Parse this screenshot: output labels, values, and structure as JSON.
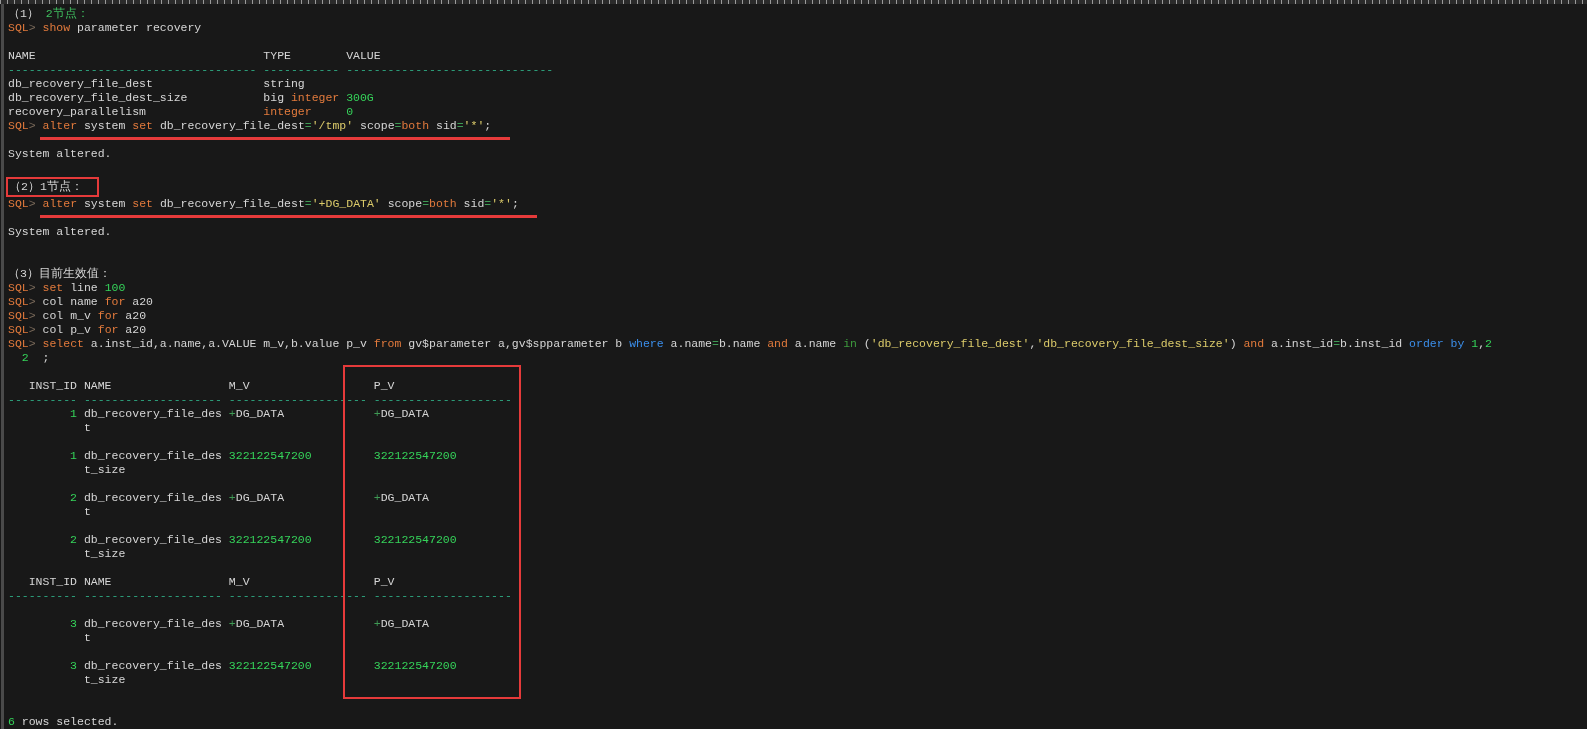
{
  "lines": [
    {
      "kind": "text",
      "segments": [
        {
          "kind": "txt",
          "text": "（1）"
        },
        {
          "kind": "head",
          "text": " 2节点："
        }
      ]
    },
    {
      "kind": "text",
      "segments": [
        {
          "kind": "prompt",
          "text": "SQL"
        },
        {
          "kind": "gt",
          "text": ">"
        },
        {
          "kind": "kw",
          "text": " show"
        },
        {
          "kind": "txt",
          "text": " parameter recovery"
        }
      ]
    },
    {
      "kind": "blank"
    },
    {
      "kind": "text",
      "segments": [
        {
          "kind": "txt",
          "text": "NAME                                 TYPE        VALUE"
        }
      ]
    },
    {
      "kind": "text",
      "segments": [
        {
          "kind": "rule",
          "text": "------------------------------------ ----------- ------------------------------"
        }
      ]
    },
    {
      "kind": "text",
      "segments": [
        {
          "kind": "txt",
          "text": "db_recovery_file_dest                string"
        }
      ]
    },
    {
      "kind": "text",
      "segments": [
        {
          "kind": "txt",
          "text": "db_recovery_file_dest_size           big "
        },
        {
          "kind": "kw",
          "text": "integer"
        },
        {
          "kind": "num",
          "text": " 300G"
        }
      ]
    },
    {
      "kind": "text",
      "segments": [
        {
          "kind": "txt",
          "text": "recovery_parallelism                 "
        },
        {
          "kind": "kw",
          "text": "integer"
        },
        {
          "kind": "num",
          "text": "     0"
        }
      ]
    },
    {
      "kind": "text",
      "underline": true,
      "segments": [
        {
          "kind": "prompt",
          "text": "SQL"
        },
        {
          "kind": "gt",
          "text": ">"
        },
        {
          "kind": "kw",
          "text": " alter"
        },
        {
          "kind": "txt",
          "text": " system "
        },
        {
          "kind": "kw",
          "text": "set"
        },
        {
          "kind": "txt",
          "text": " db_recovery_file_dest"
        },
        {
          "kind": "op",
          "text": "="
        },
        {
          "kind": "str",
          "text": "'/tmp'"
        },
        {
          "kind": "txt",
          "text": " scope"
        },
        {
          "kind": "op",
          "text": "="
        },
        {
          "kind": "kw",
          "text": "both"
        },
        {
          "kind": "txt",
          "text": " sid"
        },
        {
          "kind": "op",
          "text": "="
        },
        {
          "kind": "str",
          "text": "'*'"
        },
        {
          "kind": "txt",
          "text": ";"
        }
      ]
    },
    {
      "kind": "text",
      "segments": [
        {
          "kind": "txt",
          "text": "System altered."
        }
      ]
    },
    {
      "kind": "blank"
    },
    {
      "kind": "text",
      "boxed": true,
      "segments": [
        {
          "kind": "txt",
          "text": "（2）1节点："
        }
      ]
    },
    {
      "kind": "text",
      "underline": true,
      "segments": [
        {
          "kind": "prompt",
          "text": "SQL"
        },
        {
          "kind": "gt",
          "text": ">"
        },
        {
          "kind": "kw",
          "text": " alter"
        },
        {
          "kind": "txt",
          "text": " system "
        },
        {
          "kind": "kw",
          "text": "set"
        },
        {
          "kind": "txt",
          "text": " db_recovery_file_dest"
        },
        {
          "kind": "op",
          "text": "="
        },
        {
          "kind": "str",
          "text": "'+DG_DATA'"
        },
        {
          "kind": "txt",
          "text": " scope"
        },
        {
          "kind": "op",
          "text": "="
        },
        {
          "kind": "kw",
          "text": "both"
        },
        {
          "kind": "txt",
          "text": " sid"
        },
        {
          "kind": "op",
          "text": "="
        },
        {
          "kind": "str",
          "text": "'*'"
        },
        {
          "kind": "txt",
          "text": ";"
        }
      ]
    },
    {
      "kind": "text",
      "segments": [
        {
          "kind": "txt",
          "text": "System altered."
        }
      ]
    },
    {
      "kind": "blank"
    },
    {
      "kind": "blank"
    },
    {
      "kind": "text",
      "segments": [
        {
          "kind": "txt",
          "text": "（3）目前生效值："
        }
      ]
    },
    {
      "kind": "text",
      "segments": [
        {
          "kind": "prompt",
          "text": "SQL"
        },
        {
          "kind": "gt",
          "text": ">"
        },
        {
          "kind": "kw",
          "text": " set"
        },
        {
          "kind": "txt",
          "text": " line "
        },
        {
          "kind": "num",
          "text": "100"
        }
      ]
    },
    {
      "kind": "text",
      "segments": [
        {
          "kind": "prompt",
          "text": "SQL"
        },
        {
          "kind": "gt",
          "text": ">"
        },
        {
          "kind": "txt",
          "text": " col name "
        },
        {
          "kind": "kw",
          "text": "for"
        },
        {
          "kind": "txt",
          "text": " a20"
        }
      ]
    },
    {
      "kind": "text",
      "segments": [
        {
          "kind": "prompt",
          "text": "SQL"
        },
        {
          "kind": "gt",
          "text": ">"
        },
        {
          "kind": "txt",
          "text": " col m_v "
        },
        {
          "kind": "kw",
          "text": "for"
        },
        {
          "kind": "txt",
          "text": " a20"
        }
      ]
    },
    {
      "kind": "text",
      "segments": [
        {
          "kind": "prompt",
          "text": "SQL"
        },
        {
          "kind": "gt",
          "text": ">"
        },
        {
          "kind": "txt",
          "text": " col p_v "
        },
        {
          "kind": "kw",
          "text": "for"
        },
        {
          "kind": "txt",
          "text": " a20"
        }
      ]
    },
    {
      "kind": "text",
      "segments": [
        {
          "kind": "prompt",
          "text": "SQL"
        },
        {
          "kind": "gt",
          "text": ">"
        },
        {
          "kind": "kw",
          "text": " select"
        },
        {
          "kind": "txt",
          "text": " a.inst_id,a.name,a.VALUE m_v,b.value p_v "
        },
        {
          "kind": "kw",
          "text": "from"
        },
        {
          "kind": "txt",
          "text": " gv$parameter a,gv$spparameter b "
        },
        {
          "kind": "blue",
          "text": "where"
        },
        {
          "kind": "txt",
          "text": " a.name"
        },
        {
          "kind": "op",
          "text": "="
        },
        {
          "kind": "txt",
          "text": "b.name "
        },
        {
          "kind": "kw",
          "text": "and"
        },
        {
          "kind": "txt",
          "text": " a.name "
        },
        {
          "kind": "in",
          "text": "in"
        },
        {
          "kind": "txt",
          "text": " ("
        },
        {
          "kind": "str",
          "text": "'db_recovery_file_dest'"
        },
        {
          "kind": "txt",
          "text": ","
        },
        {
          "kind": "str",
          "text": "'db_recovery_file_dest_size'"
        },
        {
          "kind": "txt",
          "text": ") "
        },
        {
          "kind": "kw",
          "text": "and"
        },
        {
          "kind": "txt",
          "text": " a.inst_id"
        },
        {
          "kind": "op",
          "text": "="
        },
        {
          "kind": "txt",
          "text": "b.inst_id "
        },
        {
          "kind": "blue",
          "text": "order by"
        },
        {
          "kind": "num",
          "text": " 1"
        },
        {
          "kind": "txt",
          "text": ","
        },
        {
          "kind": "num",
          "text": "2"
        }
      ]
    },
    {
      "kind": "text",
      "segments": [
        {
          "kind": "num",
          "text": "  2"
        },
        {
          "kind": "txt",
          "text": "  ;"
        }
      ]
    },
    {
      "kind": "blank"
    },
    {
      "kind": "group",
      "highlight": true,
      "lines": [
        {
          "kind": "text",
          "segments": [
            {
              "kind": "txt",
              "text": "   INST_ID NAME                 M_V                  P_V"
            }
          ]
        },
        {
          "kind": "text",
          "segments": [
            {
              "kind": "rule",
              "text": "---------- -------------------- -------------------- --------------------"
            }
          ]
        },
        {
          "kind": "text",
          "segments": [
            {
              "kind": "num",
              "text": "         1"
            },
            {
              "kind": "txt",
              "text": " db_recovery_file_des "
            },
            {
              "kind": "op",
              "text": "+"
            },
            {
              "kind": "txt",
              "text": "DG_DATA             "
            },
            {
              "kind": "op",
              "text": "+"
            },
            {
              "kind": "txt",
              "text": "DG_DATA"
            }
          ]
        },
        {
          "kind": "text",
          "segments": [
            {
              "kind": "txt",
              "text": "           t"
            }
          ]
        },
        {
          "kind": "blank"
        },
        {
          "kind": "text",
          "segments": [
            {
              "kind": "num",
              "text": "         1"
            },
            {
              "kind": "txt",
              "text": " db_recovery_file_des "
            },
            {
              "kind": "num",
              "text": "322122547200"
            },
            {
              "kind": "num",
              "text": "         322122547200"
            }
          ]
        },
        {
          "kind": "text",
          "segments": [
            {
              "kind": "txt",
              "text": "           t_size"
            }
          ]
        },
        {
          "kind": "blank"
        },
        {
          "kind": "text",
          "segments": [
            {
              "kind": "num",
              "text": "         2"
            },
            {
              "kind": "txt",
              "text": " db_recovery_file_des "
            },
            {
              "kind": "op",
              "text": "+"
            },
            {
              "kind": "txt",
              "text": "DG_DATA             "
            },
            {
              "kind": "op",
              "text": "+"
            },
            {
              "kind": "txt",
              "text": "DG_DATA"
            }
          ]
        },
        {
          "kind": "text",
          "segments": [
            {
              "kind": "txt",
              "text": "           t"
            }
          ]
        },
        {
          "kind": "blank"
        },
        {
          "kind": "text",
          "segments": [
            {
              "kind": "num",
              "text": "         2"
            },
            {
              "kind": "txt",
              "text": " db_recovery_file_des "
            },
            {
              "kind": "num",
              "text": "322122547200"
            },
            {
              "kind": "num",
              "text": "         322122547200"
            }
          ]
        },
        {
          "kind": "text",
          "segments": [
            {
              "kind": "txt",
              "text": "           t_size"
            }
          ]
        },
        {
          "kind": "blank"
        },
        {
          "kind": "text",
          "segments": [
            {
              "kind": "txt",
              "text": "   INST_ID NAME                 M_V                  P_V"
            }
          ]
        },
        {
          "kind": "text",
          "segments": [
            {
              "kind": "rule",
              "text": "---------- -------------------- -------------------- --------------------"
            }
          ]
        },
        {
          "kind": "blank"
        },
        {
          "kind": "text",
          "segments": [
            {
              "kind": "num",
              "text": "         3"
            },
            {
              "kind": "txt",
              "text": " db_recovery_file_des "
            },
            {
              "kind": "op",
              "text": "+"
            },
            {
              "kind": "txt",
              "text": "DG_DATA             "
            },
            {
              "kind": "op",
              "text": "+"
            },
            {
              "kind": "txt",
              "text": "DG_DATA"
            }
          ]
        },
        {
          "kind": "text",
          "segments": [
            {
              "kind": "txt",
              "text": "           t"
            }
          ]
        },
        {
          "kind": "blank"
        },
        {
          "kind": "text",
          "segments": [
            {
              "kind": "num",
              "text": "         3"
            },
            {
              "kind": "txt",
              "text": " db_recovery_file_des "
            },
            {
              "kind": "num",
              "text": "322122547200"
            },
            {
              "kind": "num",
              "text": "         322122547200"
            }
          ]
        },
        {
          "kind": "text",
          "segments": [
            {
              "kind": "txt",
              "text": "           t_size"
            }
          ]
        }
      ]
    },
    {
      "kind": "blank"
    },
    {
      "kind": "blank"
    },
    {
      "kind": "text",
      "segments": [
        {
          "kind": "num",
          "text": "6"
        },
        {
          "kind": "txt",
          "text": " rows selected."
        }
      ]
    }
  ]
}
